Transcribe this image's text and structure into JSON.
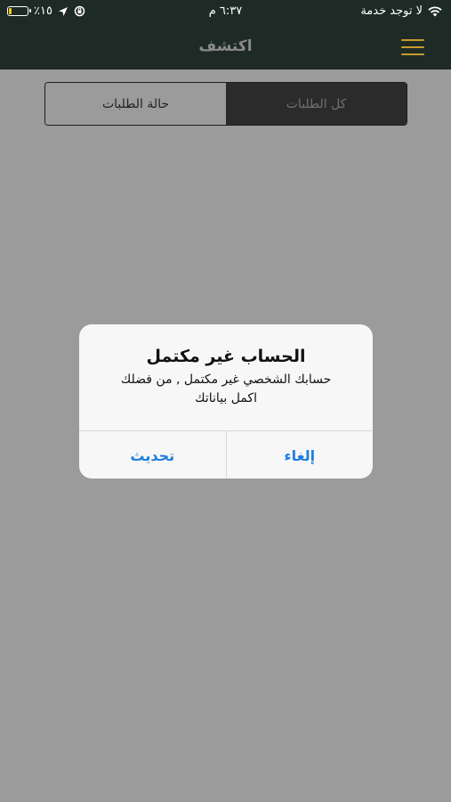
{
  "status_bar": {
    "carrier": "لا توجد خدمة",
    "time": "٦:٣٧ م",
    "battery_percent": "٪١٥",
    "battery_level": 0.15,
    "icons": [
      "wifi-icon",
      "location-arrow-icon",
      "orientation-lock-icon",
      "battery-icon"
    ]
  },
  "nav": {
    "title": "اكتشف",
    "menu_icon": "hamburger-menu-icon",
    "menu_color": "#c89b2a"
  },
  "segments": {
    "items": [
      {
        "label": "كل الطلبات",
        "active": true
      },
      {
        "label": "حالة الطلبات",
        "active": false
      }
    ]
  },
  "alert": {
    "title": "الحساب غير مكتمل",
    "message_line1": "حسابك الشخصي غير مكتمل , من فضلك",
    "message_line2": "اكمل بياناتك",
    "cancel_label": "إلغاء",
    "update_label": "تحديث",
    "button_color": "#1f7fe0"
  }
}
